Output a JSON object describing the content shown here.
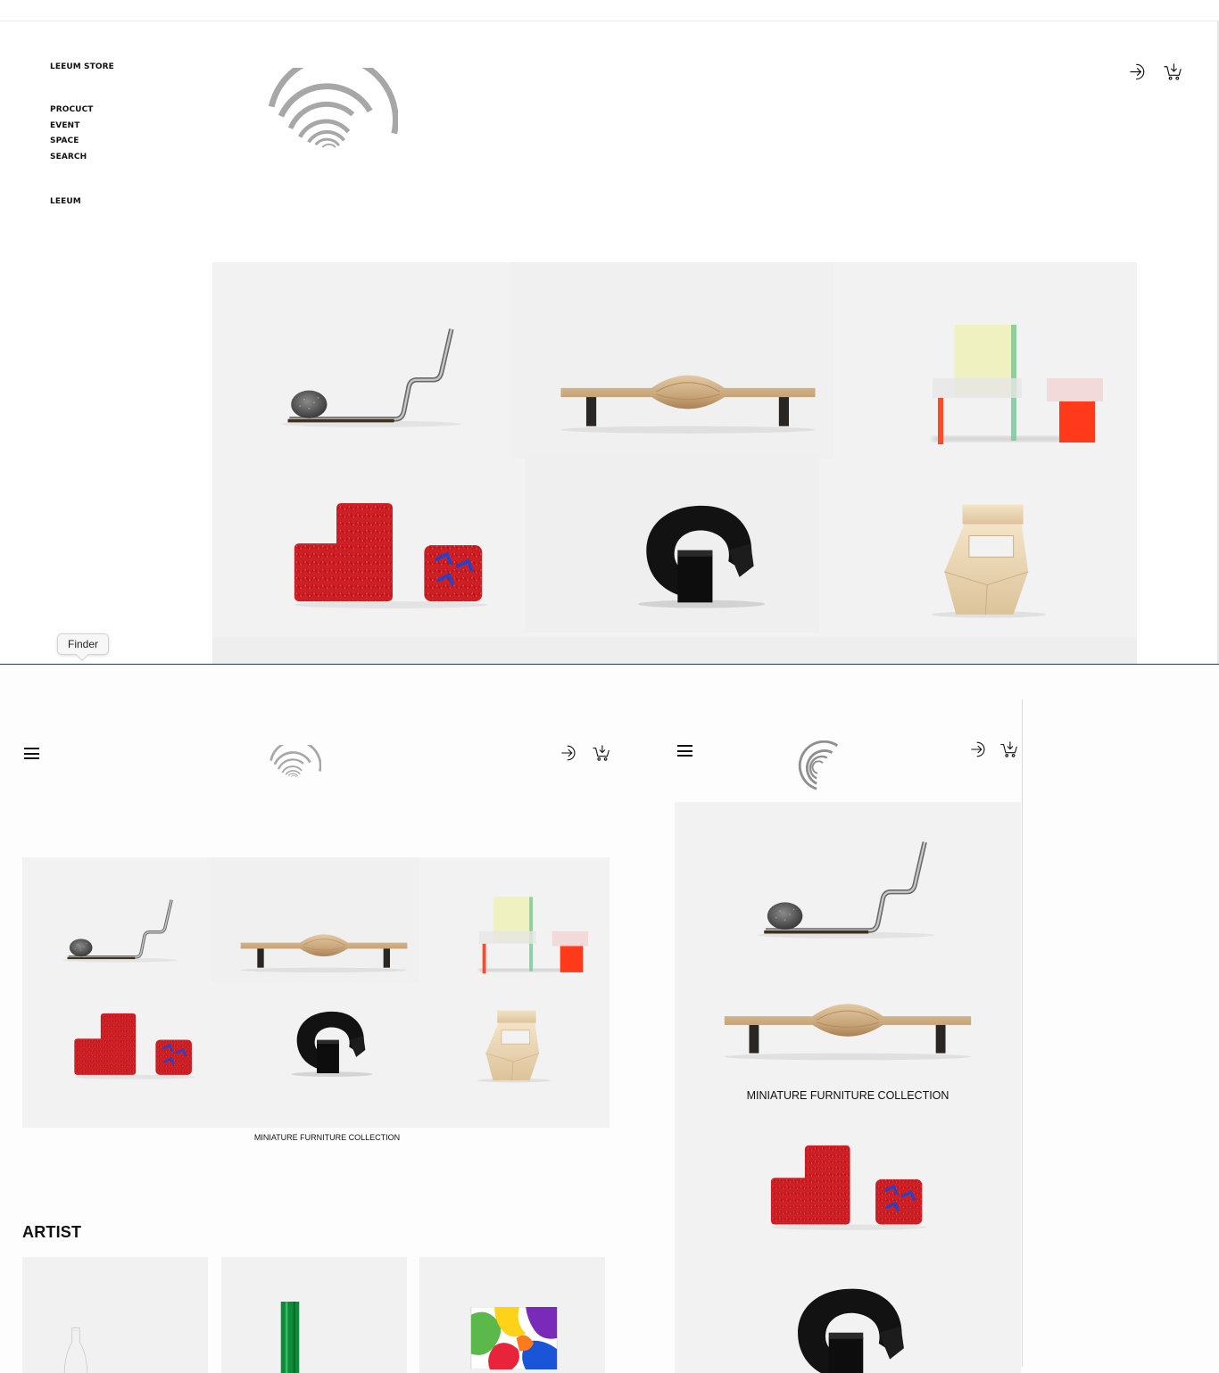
{
  "desktop": {
    "nav": {
      "store": "LEEUM STORE",
      "items": [
        "PROCUCT",
        "EVENT",
        "SPACE",
        "SEARCH"
      ],
      "home": "LEEUM"
    },
    "tooltip": "Finder"
  },
  "tablet": {
    "hero_caption": "MINIATURE FURNITURE COLLECTION",
    "artist_heading": "ARTIST"
  },
  "mobile": {
    "hero_caption": "MINIATURE FURNITURE COLLECTION"
  },
  "icons": {
    "menu": "hamburger-icon",
    "login": "login-icon",
    "cart": "cart-icon",
    "logo": "leeum-arc-logo"
  },
  "colors": {
    "hero_bg": "#f2f2f2",
    "logo_gray": "#a6a6a6",
    "knit_red": "#d8262a",
    "accent_blue": "#2244cc",
    "acrylic_orange": "#ff4a2a"
  }
}
